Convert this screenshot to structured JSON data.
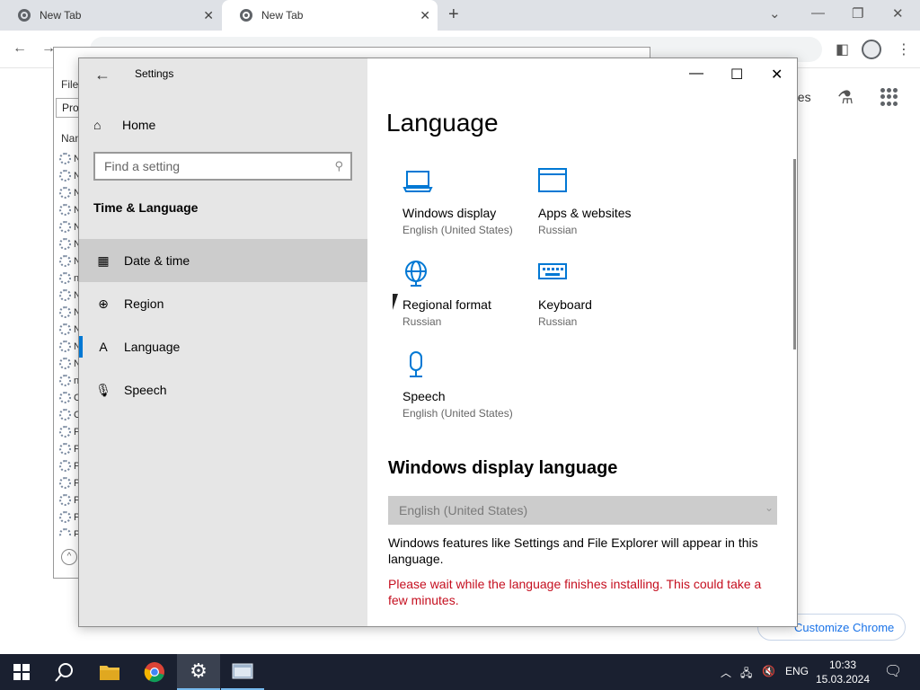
{
  "browser": {
    "tabs": [
      {
        "label": "New Tab"
      },
      {
        "label": "New Tab"
      }
    ],
    "ntp": {
      "images_link": "ges",
      "customize_label": "Customize Chrome"
    }
  },
  "background_window": {
    "menu_file": "File",
    "tab_label": "Pro",
    "column_name": "Nan",
    "rows": [
      "N",
      "N",
      "N",
      "N",
      "N",
      "N",
      "N",
      "n",
      "N",
      "N",
      "N",
      "N",
      "N",
      "n",
      "C",
      "C",
      "P",
      "P",
      "P",
      "P",
      "P",
      "P",
      "P"
    ]
  },
  "settings": {
    "app_title": "Settings",
    "home_label": "Home",
    "search_placeholder": "Find a setting",
    "section_title": "Time & Language",
    "nav": [
      {
        "label": "Date & time",
        "icon": "calendar-clock-icon",
        "selected": false,
        "hovered": true
      },
      {
        "label": "Region",
        "icon": "globe-icon",
        "selected": false
      },
      {
        "label": "Language",
        "icon": "language-icon",
        "selected": true
      },
      {
        "label": "Speech",
        "icon": "microphone-icon",
        "selected": false
      }
    ],
    "page_title": "Language",
    "tiles": [
      {
        "label": "Windows display",
        "sub": "English (United States)",
        "icon": "laptop-icon"
      },
      {
        "label": "Apps & websites",
        "sub": "Russian",
        "icon": "window-icon"
      },
      {
        "label": "Regional format",
        "sub": "Russian",
        "icon": "globe-icon"
      },
      {
        "label": "Keyboard",
        "sub": "Russian",
        "icon": "keyboard-icon"
      },
      {
        "label": "Speech",
        "sub": "English (United States)",
        "icon": "microphone-icon"
      }
    ],
    "display_language": {
      "heading": "Windows display language",
      "selected": "English (United States)",
      "description": "Windows features like Settings and File Explorer will appear in this language.",
      "warning": "Please wait while the language finishes installing. This could take a few minutes."
    }
  },
  "colors": {
    "accent": "#0078d4",
    "warning": "#c50f1f",
    "taskbar": "#1a2030",
    "sidebar": "#e6e6e6"
  },
  "taskbar": {
    "language": "ENG",
    "time": "10:33",
    "date": "15.03.2024"
  }
}
